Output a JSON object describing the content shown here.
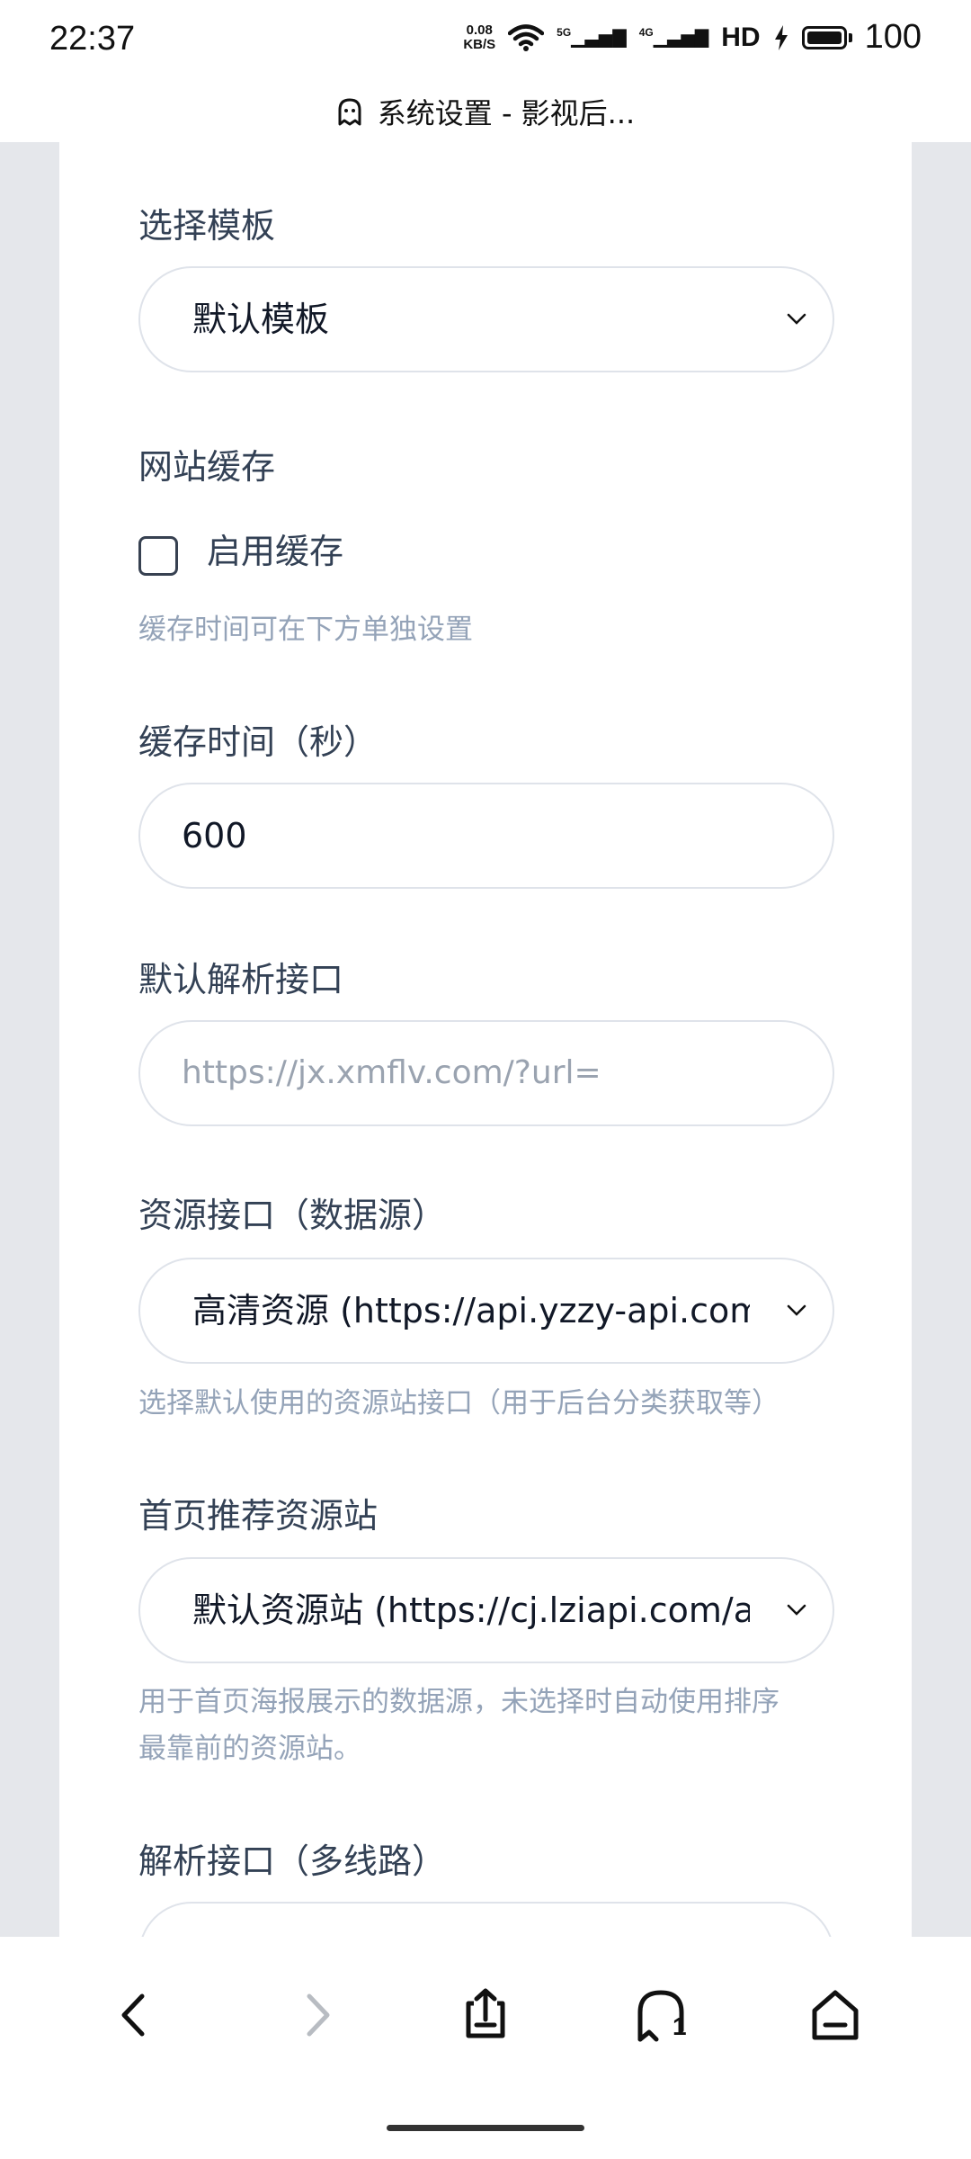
{
  "status_bar": {
    "time": "22:37",
    "net_speed_value": "0.08",
    "net_speed_unit": "KB/S",
    "signal1": "5G",
    "signal2": "4G",
    "hd": "HD",
    "battery": "100"
  },
  "title_bar": {
    "icon": "ghost-icon",
    "title": "系统设置 - 影视后..."
  },
  "form": {
    "template": {
      "label": "选择模板",
      "value": "默认模板"
    },
    "cache": {
      "label": "网站缓存",
      "checkbox_label": "启用缓存",
      "checked": false,
      "hint": "缓存时间可在下方单独设置"
    },
    "cache_time": {
      "label": "缓存时间（秒）",
      "value": "600"
    },
    "parse_api": {
      "label": "默认解析接口",
      "placeholder": "https://jx.xmflv.com/?url="
    },
    "resource_api": {
      "label": "资源接口（数据源）",
      "value": "高清资源 (https://api.yzzy-api.com/",
      "hint": "选择默认使用的资源站接口（用于后台分类获取等）"
    },
    "home_source": {
      "label": "首页推荐资源站",
      "value": "默认资源站 (https://cj.lziapi.com/ap",
      "hint_line1": "用于首页海报展示的数据源，未选择时自动使用排序",
      "hint_line2": "最靠前的资源站。"
    },
    "multi_parse": {
      "label": "解析接口（多线路）"
    }
  },
  "nav": {
    "back": "back-icon",
    "forward": "forward-icon",
    "share": "share-icon",
    "tabs": "tabs-icon",
    "tabs_count": "1",
    "home": "home-icon"
  },
  "colors": {
    "page_bg": "#e5e7eb",
    "card_bg": "#ffffff",
    "label": "#334155",
    "hint": "#94a3b8",
    "border": "#dfe3ea"
  }
}
